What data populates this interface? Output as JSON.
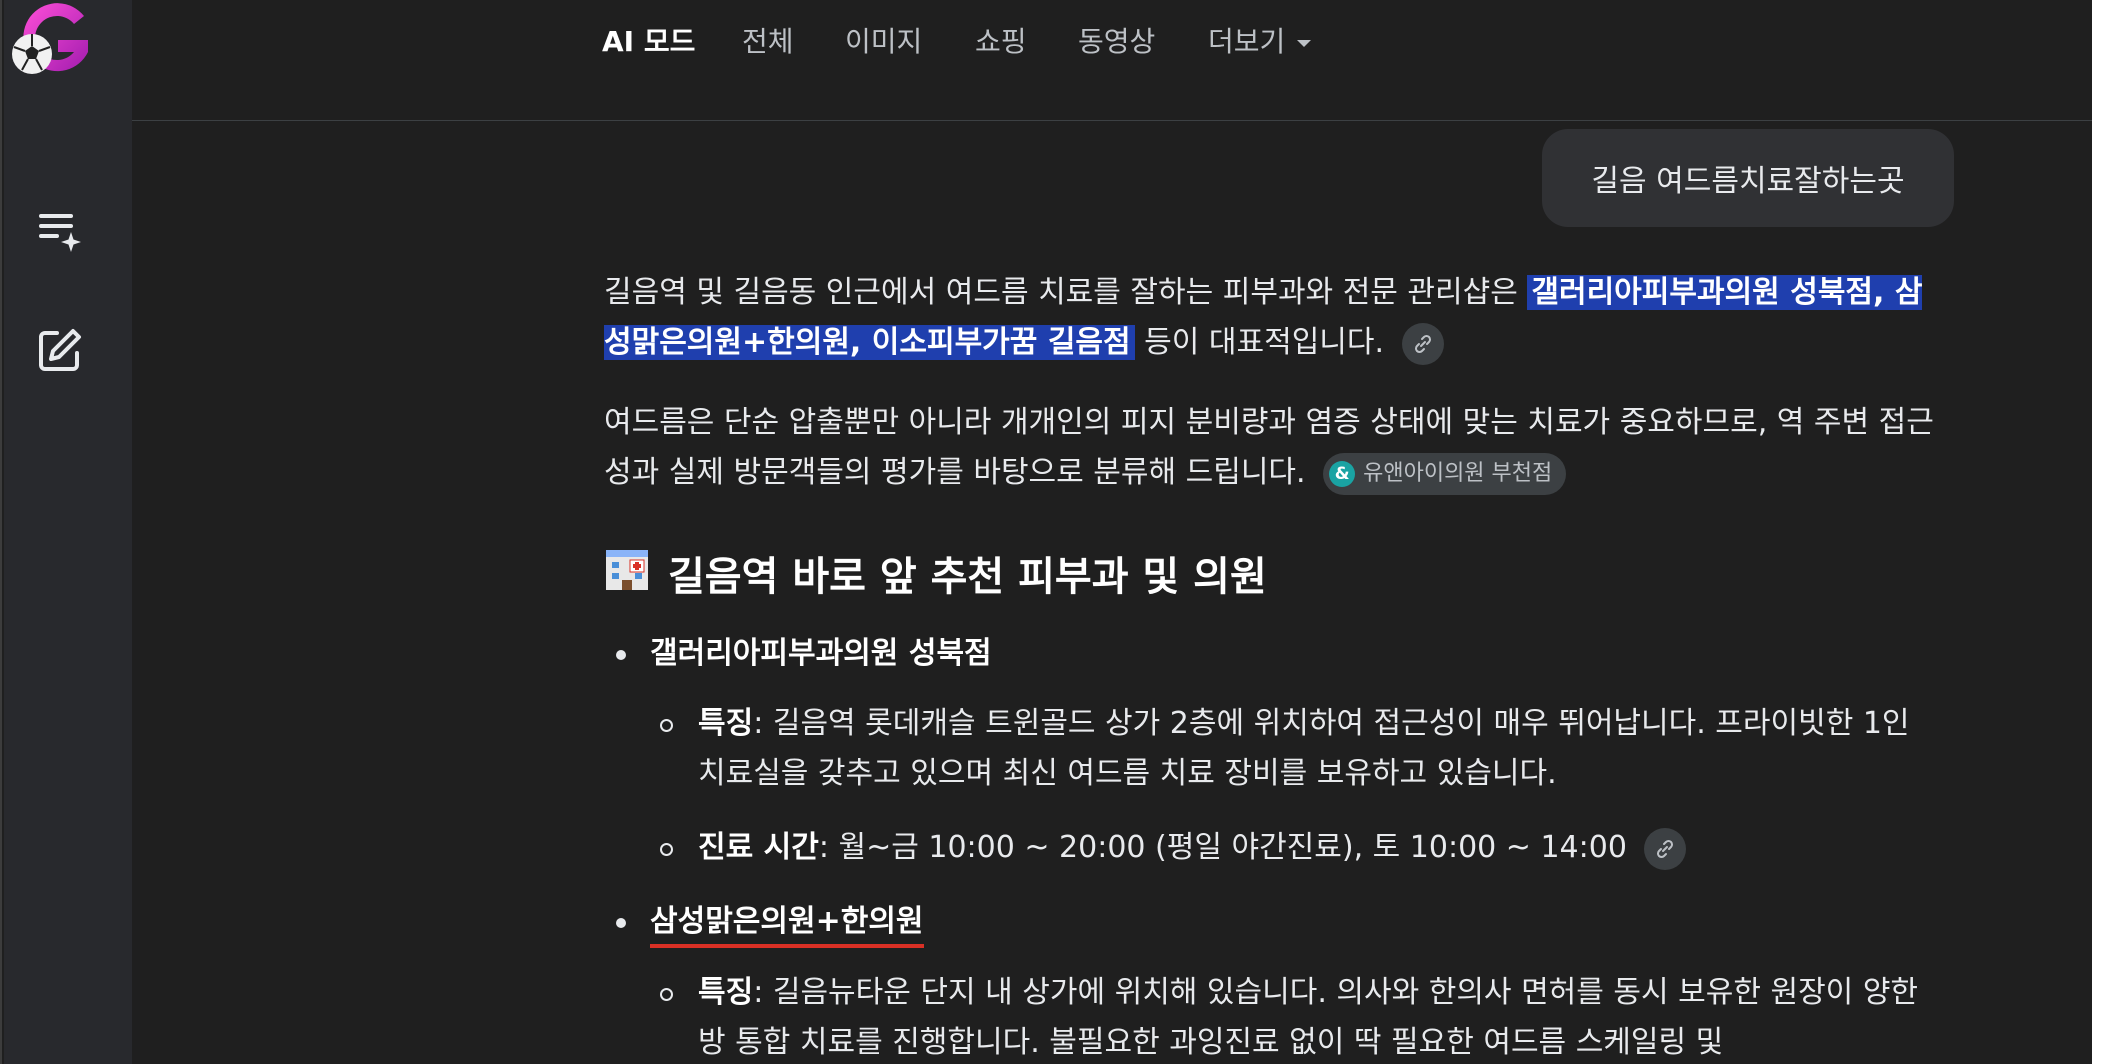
{
  "nav": {
    "tabs": [
      {
        "label": "AI 모드",
        "active": true
      },
      {
        "label": "전체"
      },
      {
        "label": "이미지"
      },
      {
        "label": "쇼핑"
      },
      {
        "label": "동영상"
      },
      {
        "label": "더보기"
      }
    ]
  },
  "query": "길음 여드름치료잘하는곳",
  "answer": {
    "intro_text": "길음역 및 길음동 인근에서 여드름 치료를 잘하는 피부과와 전문 관리샵은",
    "intro_highlight": "갤러리아피부과의원 성북점, 삼성맑은의원+한의원, 이소피부가꿈 길음점",
    "intro_tail": "등이 대표적입니다.",
    "para2": "여드름은 단순 압출뿐만 아니라 개개인의 피지 분비량과 염증 상태에 맞는 치료가 중요하므로, 역 주변 접근성과 실제 방문객들의 평가를 바탕으로 분류해 드립니다.",
    "source_chip": "유앤아이의원 부천점",
    "source_icon_letter": "&",
    "section_title": "길음역 바로 앞 추천 피부과 및 의원",
    "clinics": [
      {
        "name": "갤러리아피부과의원 성북점",
        "details": [
          {
            "label": "특징",
            "text": ": 길음역 롯데캐슬 트윈골드 상가 2층에 위치하여 접근성이 매우 뛰어납니다. 프라이빗한 1인 치료실을 갖추고 있으며 최신 여드름 치료 장비를 보유하고 있습니다."
          },
          {
            "label": "진료 시간",
            "text": ": 월~금 10:00 ~ 20:00 (평일 야간진료), 토 10:00 ~ 14:00"
          }
        ]
      },
      {
        "name": "삼성맑은의원+한의원",
        "details": [
          {
            "label": "특징",
            "text": ": 길음뉴타운 단지 내 상가에 위치해 있습니다. 의사와 한의사 면허를 동시 보유한 원장이 양한방 통합 치료를 진행합니다. 불필요한 과잉진료 없이 딱 필요한 여드름 스케일링 및"
          }
        ]
      }
    ]
  },
  "icons": {
    "logo": "g-soccer-logo-icon",
    "sidebar_history": "list-sparkle-icon",
    "sidebar_new": "edit-icon",
    "link": "link-icon"
  },
  "colors": {
    "background": "#1f1f1f",
    "sidebar": "#28292d",
    "highlight": "#1f3fae",
    "underline": "#d93025"
  }
}
